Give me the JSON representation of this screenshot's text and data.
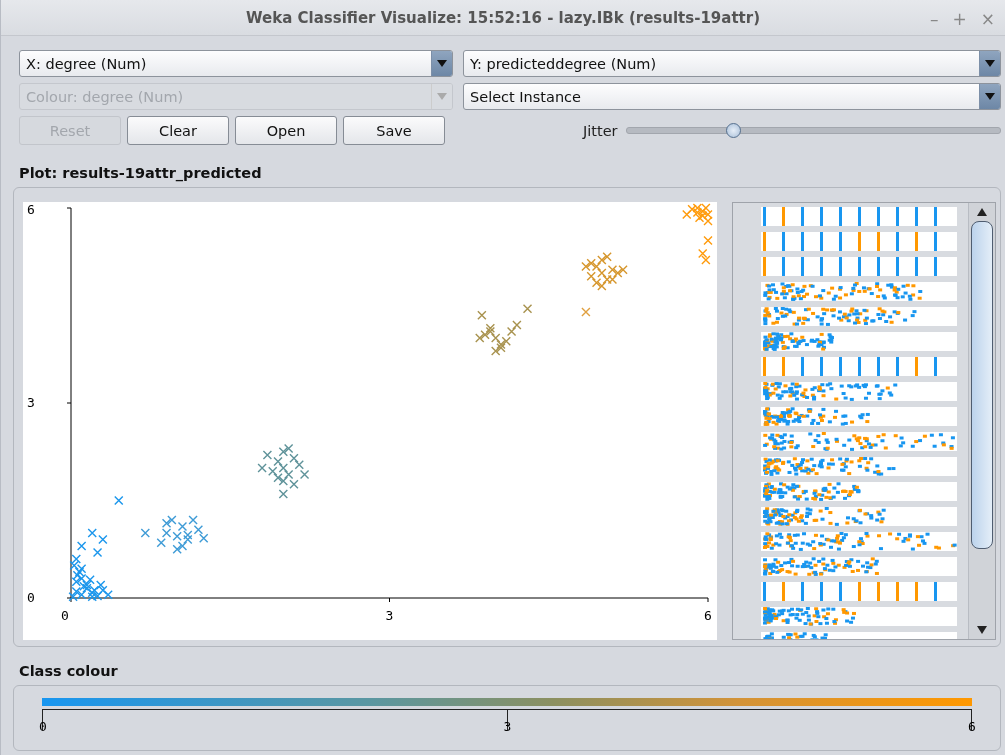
{
  "window": {
    "title": "Weka Classifier Visualize: 15:52:16 - lazy.IBk (results-19attr)",
    "controls": [
      "–",
      "+",
      "×"
    ]
  },
  "x_axis_select": {
    "value": "X: degree (Num)",
    "disabled": false
  },
  "y_axis_select": {
    "value": "Y: predicteddegree (Num)",
    "disabled": false
  },
  "colour_select": {
    "value": "Colour: degree (Num)",
    "disabled": true
  },
  "instance_select": {
    "value": "Select Instance",
    "disabled": false
  },
  "buttons": [
    {
      "label": "Reset",
      "disabled": true
    },
    {
      "label": "Clear",
      "disabled": false
    },
    {
      "label": "Open",
      "disabled": false
    },
    {
      "label": "Save",
      "disabled": false
    }
  ],
  "jitter": {
    "label": "Jitter",
    "level": 0.29
  },
  "plot": {
    "title": "Plot: results-19attr_predicted",
    "chart_data": {
      "type": "scatter",
      "xlim": [
        0,
        6
      ],
      "ylim": [
        0,
        6
      ],
      "xticks": [
        0,
        3,
        6
      ],
      "yticks": [
        0,
        3,
        6
      ],
      "series": [
        {
          "color": "#1a96ec",
          "marker": "cross",
          "x": [
            0.02,
            0.05,
            0.1,
            0.15,
            0.2,
            0.25,
            0.3,
            0.05,
            0.1,
            0.15,
            0.2,
            0.08,
            0.12,
            0.03,
            0.18,
            0.35,
            0.28,
            0.06,
            0.22,
            0.1
          ],
          "values": [
            0.02,
            0.1,
            0.05,
            0.15,
            0.08,
            0.03,
            0.12,
            0.25,
            0.3,
            0.2,
            0.02,
            0.4,
            0.18,
            0.5,
            0.28,
            0.05,
            0.2,
            0.35,
            0.12,
            0.45
          ]
        },
        {
          "color": "#1a96ec",
          "marker": "cross",
          "x": [
            0.45,
            0.2,
            0.1,
            0.25,
            0.05,
            0.3
          ],
          "values": [
            1.5,
            1.0,
            0.8,
            0.7,
            0.6,
            0.9
          ]
        },
        {
          "color": "#3e9bd6",
          "marker": "cross",
          "x": [
            0.9,
            1.0,
            1.05,
            1.1,
            0.95,
            1.2,
            0.85,
            1.0,
            1.15,
            1.25,
            0.7,
            1.05,
            0.9,
            1.1
          ],
          "values": [
            1.0,
            0.95,
            1.1,
            0.9,
            1.2,
            1.05,
            0.85,
            0.75,
            1.2,
            0.92,
            1.0,
            0.8,
            1.15,
            0.97
          ]
        },
        {
          "color": "#5e9299",
          "marker": "cross",
          "x": [
            2.0,
            1.95,
            2.05,
            2.1,
            1.9,
            2.15,
            1.85,
            2.0,
            2.2,
            1.8,
            2.05,
            1.95,
            2.1,
            2.0
          ],
          "values": [
            2.0,
            2.1,
            1.9,
            2.15,
            1.95,
            2.05,
            2.2,
            1.8,
            1.9,
            2.0,
            2.3,
            1.85,
            1.75,
            2.25
          ]
        },
        {
          "color": "#5e9299",
          "marker": "cross",
          "x": [
            2.0
          ],
          "values": [
            1.6
          ]
        },
        {
          "color": "#a8924e",
          "marker": "cross",
          "x": [
            4.0,
            3.95,
            4.05,
            4.1,
            3.9,
            4.15,
            3.85,
            4.0,
            4.2,
            4.05,
            3.95
          ],
          "values": [
            4.0,
            4.1,
            3.9,
            3.95,
            4.05,
            4.1,
            4.0,
            3.8,
            4.2,
            3.85,
            4.15
          ]
        },
        {
          "color": "#a8924e",
          "marker": "cross",
          "x": [
            3.87,
            4.3
          ],
          "values": [
            4.35,
            4.45
          ]
        },
        {
          "color": "#d6962c",
          "marker": "cross",
          "x": [
            5.0,
            4.95,
            5.05,
            5.1,
            4.9,
            5.15,
            4.85,
            5.0,
            5.2,
            5.05,
            4.95,
            5.0,
            4.9,
            5.1
          ],
          "values": [
            5.0,
            5.1,
            4.9,
            5.05,
            4.95,
            5.0,
            5.1,
            4.8,
            5.05,
            5.25,
            4.85,
            5.2,
            5.15,
            4.9
          ]
        },
        {
          "color": "#e0a040",
          "marker": "cross",
          "x": [
            4.85
          ],
          "values": [
            4.4
          ]
        },
        {
          "color": "#ff9a0a",
          "marker": "cross",
          "x": [
            5.9,
            5.95,
            6.0,
            5.85,
            5.92,
            5.98,
            5.8,
            6.0,
            5.9,
            5.95
          ],
          "values": [
            6.0,
            5.95,
            5.9,
            5.98,
            5.85,
            6.0,
            5.9,
            5.8,
            5.93,
            5.88
          ]
        },
        {
          "color": "#ff9a0a",
          "marker": "cross",
          "x": [
            5.95,
            6.0,
            5.98
          ],
          "values": [
            5.3,
            5.5,
            5.2
          ]
        }
      ]
    }
  },
  "class_colour": {
    "title": "Class colour",
    "ticks": [
      "0",
      "3",
      "6"
    ]
  }
}
